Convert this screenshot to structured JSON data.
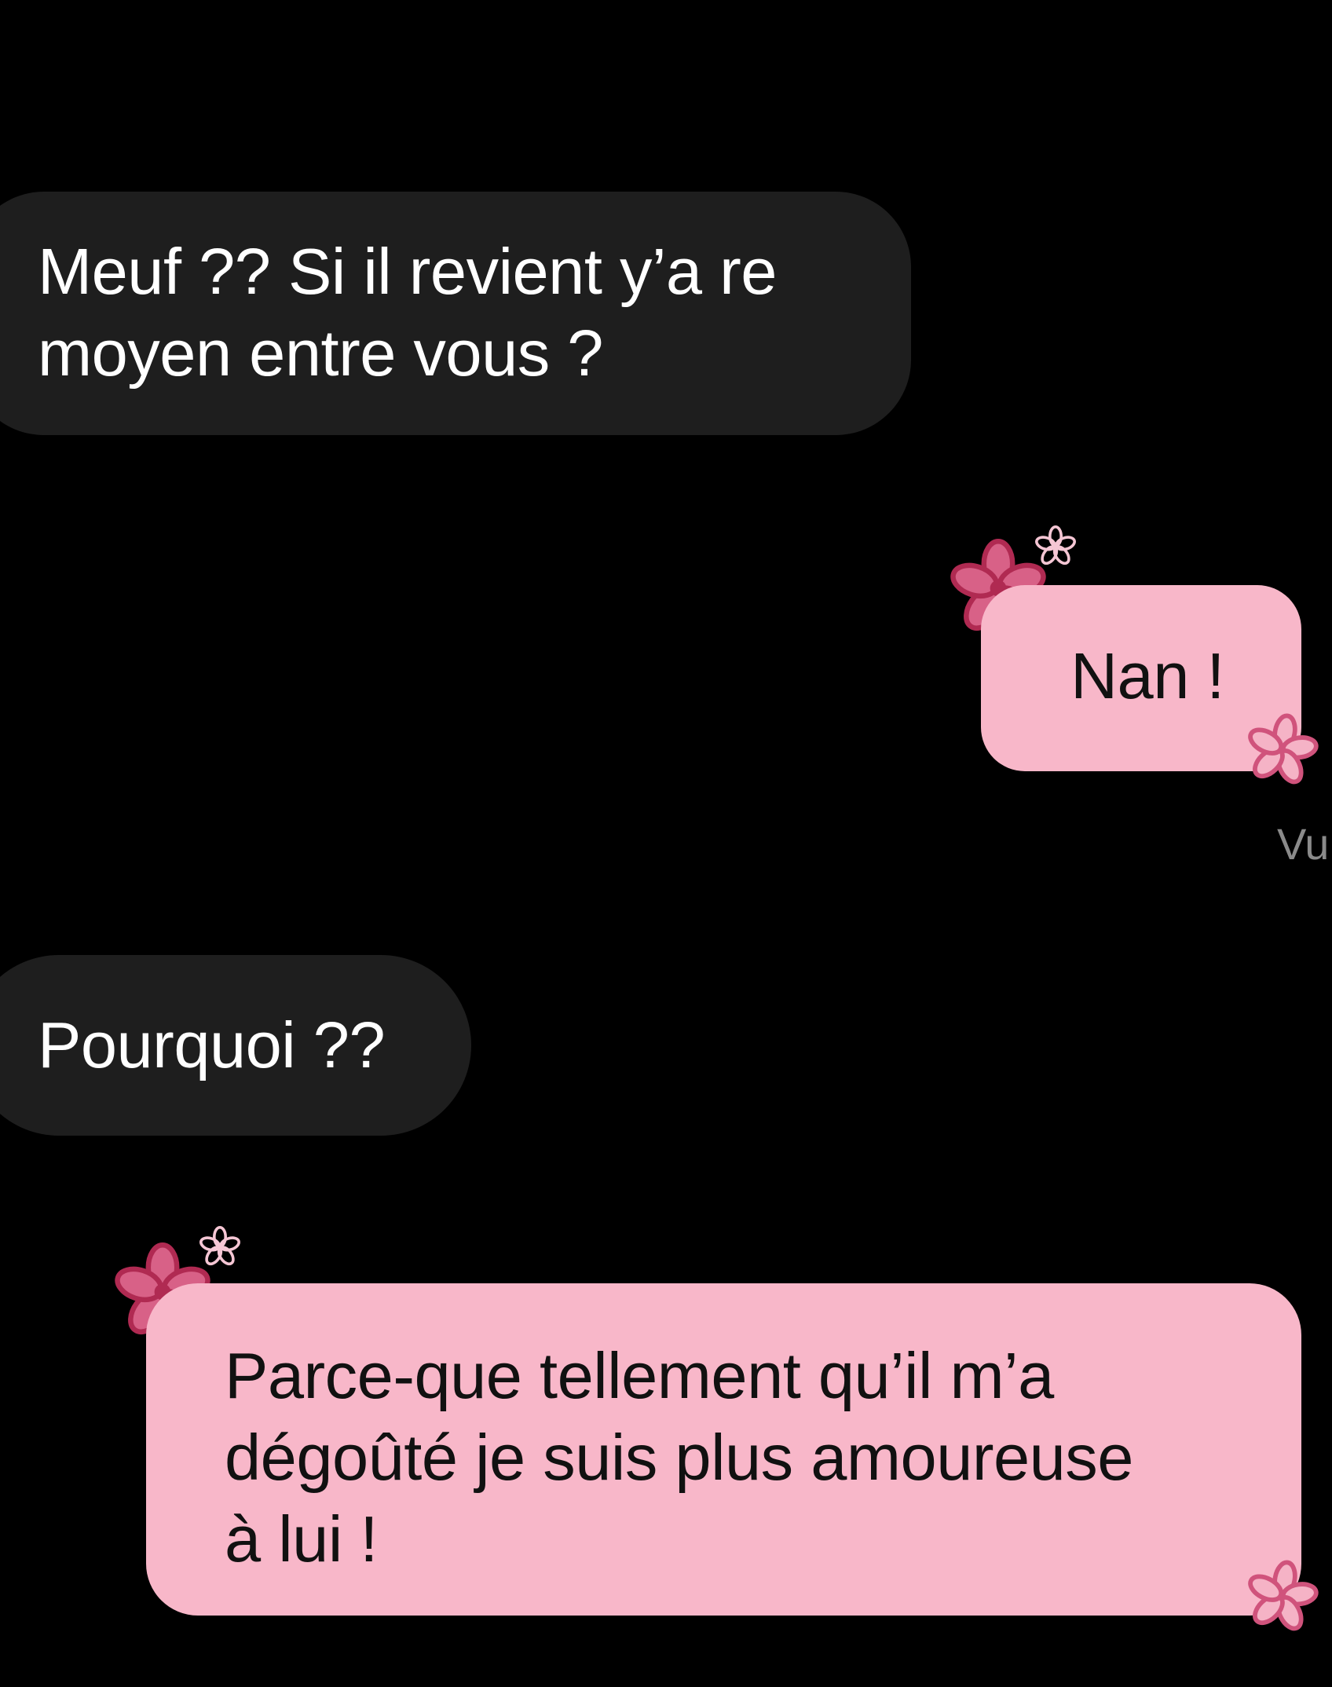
{
  "conversation": {
    "messages": [
      {
        "sender": "them",
        "text": "Meuf ?? Si il revient y’a re\nmoyen entre vous ?"
      },
      {
        "sender": "me",
        "text": "Nan !"
      },
      {
        "sender": "them",
        "text": "Pourquoi ??"
      },
      {
        "sender": "me",
        "text": "Parce-que tellement qu’il m’a\ndégoûté je suis plus amoureuse\nà lui !"
      }
    ],
    "seen_label": "Vu"
  },
  "colors": {
    "background": "#000000",
    "incoming_bubble": "#1e1e1e",
    "outgoing_bubble": "#f8b7c9",
    "flower_outline": "#b02a52",
    "flower_fill": "#d86187"
  },
  "icons": {
    "bubble_decoration": "flower-icon"
  }
}
